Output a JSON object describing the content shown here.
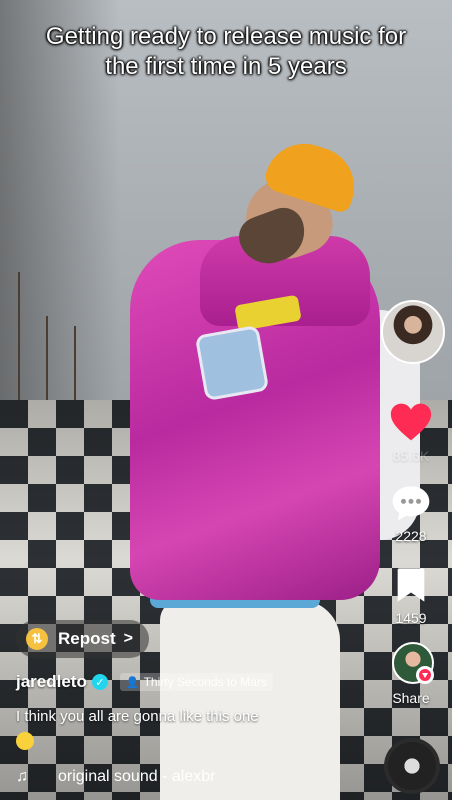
{
  "caption": "Getting ready to release music for the first time in 5 years",
  "rail": {
    "likes": "85.6K",
    "comments": "2228",
    "bookmarks": "1459",
    "share_label": "Share"
  },
  "repost": {
    "label": "Repost",
    "chevron": ">"
  },
  "author": {
    "username": "jaredleto",
    "verified_mark": "✓",
    "group_label": "Thirty Seconds to Mars"
  },
  "description": "I think you all are gonna like this one",
  "sound": {
    "label": "original sound - alexbr"
  },
  "colors": {
    "like_red": "#fe2c55",
    "verified_blue": "#20d5ec",
    "repost_yellow": "#f6c13f"
  }
}
